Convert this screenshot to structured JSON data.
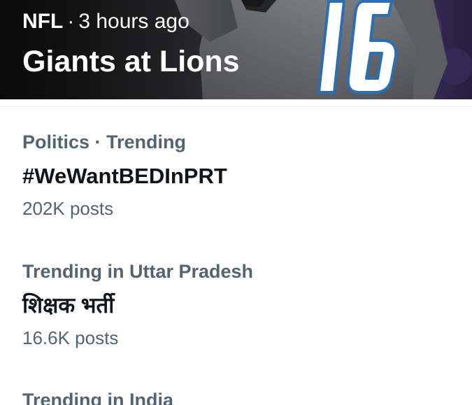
{
  "featured": {
    "category": "NFL",
    "separator": "·",
    "time": "3 hours ago",
    "title": "Giants at Lions",
    "jersey_number": "16"
  },
  "trends": [
    {
      "context": "Politics · Trending",
      "name": "#WeWantBEDInPRT",
      "posts": "202K posts"
    },
    {
      "context": "Trending in Uttar Pradesh",
      "name": "शिक्षक भर्ती",
      "posts": "16.6K posts"
    },
    {
      "context": "Trending in India"
    }
  ],
  "colors": {
    "primary_text": "#0f1419",
    "secondary_text": "#536471",
    "background": "#ffffff"
  }
}
